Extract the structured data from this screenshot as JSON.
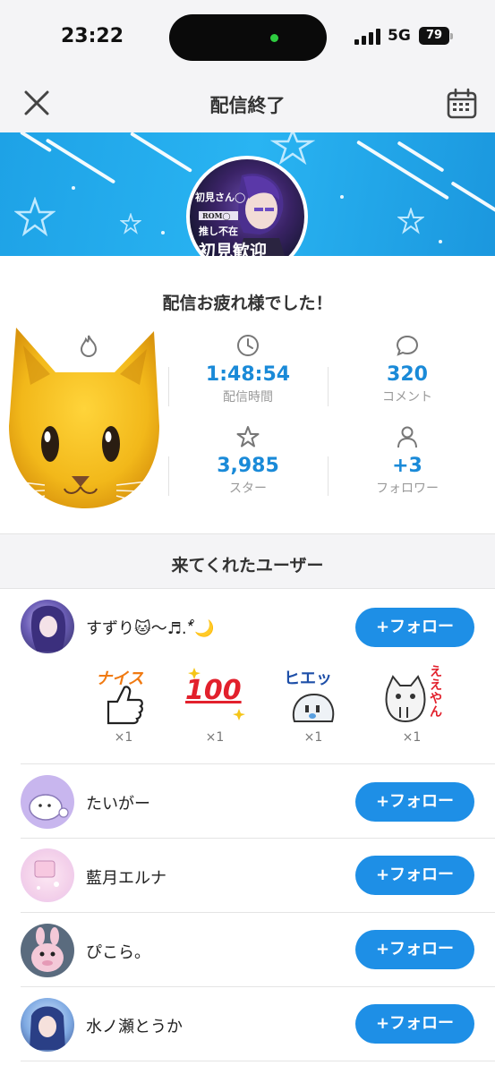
{
  "status": {
    "time": "23:22",
    "network": "5G",
    "battery": "79"
  },
  "nav": {
    "title": "配信終了",
    "close_icon": "close-icon",
    "calendar_icon": "calendar-icon"
  },
  "banner": {
    "avatar_texts": [
      "初見さん◯",
      "ROM◯",
      "推し不在",
      "初見歓迎"
    ]
  },
  "summary": {
    "thanks": "配信お疲れ様でした！",
    "stats": [
      {
        "icon": "flame-icon",
        "value": "",
        "label": ""
      },
      {
        "icon": "clock-icon",
        "value": "1:48:54",
        "label": "配信時間"
      },
      {
        "icon": "comment-icon",
        "value": "320",
        "label": "コメント"
      },
      {
        "icon": "heart-icon",
        "value": "",
        "label": ""
      },
      {
        "icon": "star-icon",
        "value": "3,985",
        "label": "スター"
      },
      {
        "icon": "person-icon",
        "value": "+3",
        "label": "フォロワー"
      }
    ]
  },
  "visitors": {
    "title": "来てくれたユーザー",
    "follow_label": "+フォロー",
    "users": [
      {
        "name": "すずり🐱〜♬.*゚🌙"
      },
      {
        "name": "たいがー"
      },
      {
        "name": "藍月エルナ"
      },
      {
        "name": "ぴこら。"
      },
      {
        "name": "水ノ瀬とうか"
      }
    ],
    "stamps": [
      {
        "text": "ナイス",
        "count": "×1"
      },
      {
        "text": "100",
        "count": "×1"
      },
      {
        "text": "ヒエッ",
        "count": "×1"
      },
      {
        "text": "ええやん",
        "count": "×1"
      }
    ]
  },
  "colors": {
    "accent": "#1e8fe6",
    "value_blue": "#1a8ad8",
    "banner": "#29b4f2"
  }
}
